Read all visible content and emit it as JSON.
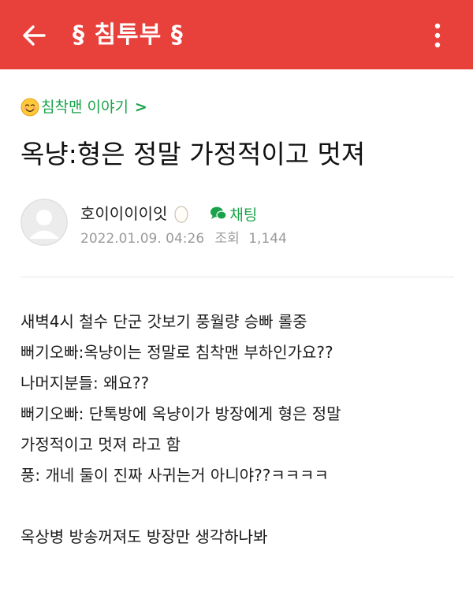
{
  "header": {
    "title": "§ 침투부 §",
    "back_icon": "arrow-left-icon",
    "menu_icon": "more-vertical-icon",
    "bg_color": "#e8403b"
  },
  "board": {
    "icon": "smiling-face-emoji",
    "name": "침착맨 이야기",
    "chevron": ">",
    "color": "#1aa34a"
  },
  "post": {
    "title": "옥냥:형은 정말 가정적이고 멋져",
    "author": {
      "name": "호이이이이잇",
      "level_icon": "egg-icon",
      "avatar_icon": "default-avatar-icon"
    },
    "chat_label": "채팅",
    "chat_icon": "chat-bubble-icon",
    "date": "2022.01.09. 04:26",
    "views_label": "조회",
    "views": "1,144",
    "body_lines": [
      "새벽4시 철수 단군 갓보기 풍월량 승빠 롤중",
      "뻐기오빠:옥냥이는 정말로 침착맨 부하인가요??",
      "나머지분들: 왜요??",
      "뻐기오빠: 단톡방에 옥냥이가  방장에게 형은 정말",
      "가정적이고 멋져 라고 함",
      "풍: 개네 둘이 진짜 사귀는거 아니야??ㅋㅋㅋㅋ",
      "",
      "옥상병 방송꺼져도 방장만 생각하나봐"
    ]
  }
}
